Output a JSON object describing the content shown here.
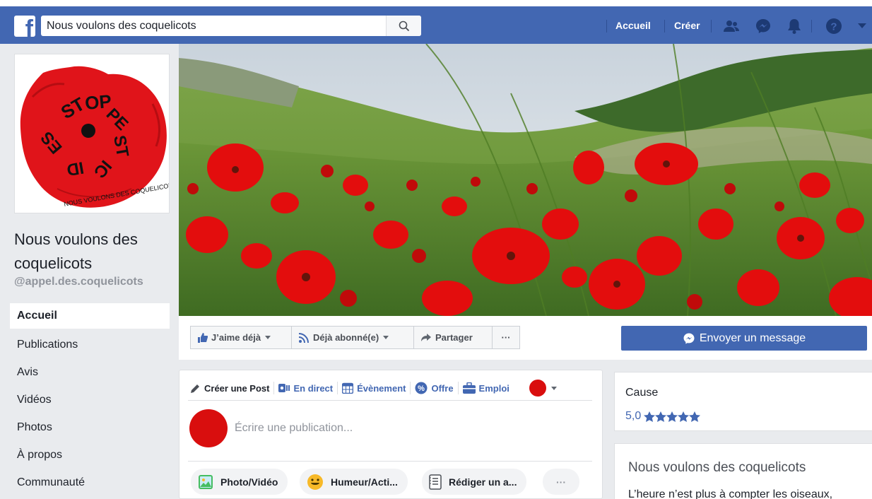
{
  "topbar": {
    "logo_letter": "f",
    "search_value": "Nous voulons des coquelicots",
    "nav_home": "Accueil",
    "nav_create": "Créer",
    "brand_color": "#4267b2",
    "icons": [
      "friends-icon",
      "messenger-icon",
      "bell-icon",
      "help-icon",
      "caret-down-icon"
    ]
  },
  "page": {
    "name": "Nous voulons des coquelicots",
    "handle": "@appel.des.coquelicots",
    "logo_text_top": "STOP PESTICIDES",
    "logo_text_bottom": "NOUS VOULONS DES COQUELICOTS",
    "logo_color": "#e0141a"
  },
  "left_nav": [
    {
      "label": "Accueil",
      "active": true
    },
    {
      "label": "Publications"
    },
    {
      "label": "Avis"
    },
    {
      "label": "Vidéos"
    },
    {
      "label": "Photos"
    },
    {
      "label": "À propos"
    },
    {
      "label": "Communauté"
    }
  ],
  "actions": {
    "like": "J’aime déjà",
    "follow": "Déjà abonné(e)",
    "share": "Partager",
    "more": "···",
    "message": "Envoyer un message"
  },
  "composer": {
    "tabs": {
      "create": "Créer une Post",
      "live": "En direct",
      "event": "Évènement",
      "offer": "Offre",
      "job": "Emploi"
    },
    "placeholder": "Écrire une publication...",
    "pills": {
      "photo": "Photo/Vidéo",
      "feeling": "Humeur/Acti...",
      "note": "Rédiger un a...",
      "more": "···"
    }
  },
  "right": {
    "category": "Cause",
    "rating": "5,0",
    "stars": 5,
    "about_title": "Nous voulons des coquelicots",
    "about_text": "L’heure n’est plus à compter les oiseaux,"
  }
}
